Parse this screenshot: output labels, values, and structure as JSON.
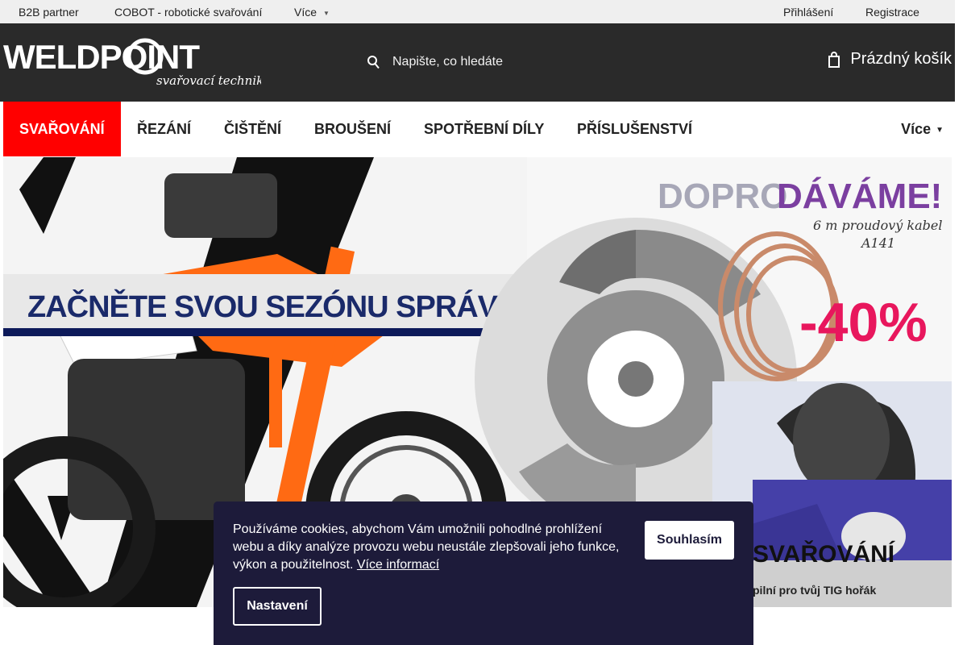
{
  "topbar": {
    "b2b": "B2B partner",
    "cobot": "COBOT - robotické svařování",
    "more": "Více",
    "login": "Přihlášení",
    "register": "Registrace"
  },
  "header": {
    "logo_main": "WELDPOINT",
    "logo_sub": "svařovací technika",
    "search_placeholder": "Napište, co hledáte",
    "cart_label": "Prázdný košík"
  },
  "nav": {
    "items": [
      "SVAŘOVÁNÍ",
      "ŘEZÁNÍ",
      "ČIŠTĚNÍ",
      "BROUŠENÍ",
      "SPOTŘEBNÍ DÍLY",
      "PŘÍSLUŠENSTVÍ"
    ],
    "more": "Více"
  },
  "banner": {
    "slogan": "ZAČNĚTE SVOU SEZÓNU SPRÁVNĚ.",
    "promo_gray": "DOPRO",
    "promo_purple": "DÁVÁME!",
    "promo_sub1": "6 m proudový kabel",
    "promo_sub2": "A141",
    "discount": "-40%",
    "weld_title": "SVAŘOVÁNÍ",
    "weld_sub": "pilní pro tvůj TIG hořák"
  },
  "cookie": {
    "text": "Používáme cookies, abychom Vám umožnili pohodlné prohlížení webu a díky analýze provozu webu neustále zlepšovali jeho funkce, výkon a použitelnost.",
    "more_link": "Více informací",
    "agree": "Souhlasím",
    "settings": "Nastavení"
  },
  "colors": {
    "accent_red": "#ff0000",
    "header_bg": "#2a2a2a",
    "cookie_bg": "#1d1b3a",
    "promo_purple": "#7b3fa0"
  }
}
